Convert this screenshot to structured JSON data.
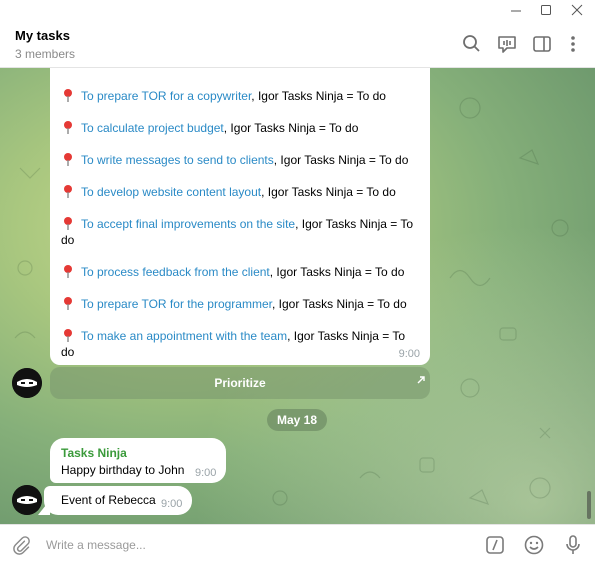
{
  "window": {
    "controls": [
      "minimize-icon",
      "maximize-icon",
      "close-icon"
    ]
  },
  "header": {
    "title": "My tasks",
    "subtitle": "3 members",
    "icons": [
      "search-icon",
      "voice-chat-icon",
      "sidebar-icon",
      "more-icon"
    ]
  },
  "messages": {
    "task_list": [
      {
        "link": "To prepare TOR for a copywriter",
        "rest": ", Igor Tasks Ninja = To do"
      },
      {
        "link": "To calculate project budget",
        "rest": ", Igor Tasks Ninja = To do"
      },
      {
        "link": "To write messages to send to clients",
        "rest": ", Igor Tasks Ninja = To do"
      },
      {
        "link": "To develop website content layout",
        "rest": ", Igor Tasks Ninja = To do"
      },
      {
        "link": "To accept final improvements on the site",
        "rest": ", Igor Tasks Ninja = To do"
      },
      {
        "link": "To process feedback from the client",
        "rest": ", Igor Tasks Ninja = To do"
      },
      {
        "link": "To prepare TOR for the programmer",
        "rest": ", Igor Tasks Ninja = To do"
      },
      {
        "link": "To make an appointment with the team",
        "rest": ", Igor Tasks Ninja = To do"
      }
    ],
    "task_list_time": "9:00",
    "inline_button": "Prioritize",
    "date_separator": "May 18",
    "sender": "Tasks Ninja",
    "msg1": {
      "text": "Happy birthday to John",
      "time": "9:00"
    },
    "msg2": {
      "text": "Event of Rebecca",
      "time": "9:00"
    }
  },
  "composer": {
    "placeholder": "Write a message...",
    "icons": [
      "attach-icon",
      "bot-commands-icon",
      "emoji-icon",
      "microphone-icon"
    ]
  },
  "colors": {
    "link": "#2a8ac6",
    "sender": "#3a9a3a",
    "chat_bg": "#86b07a"
  }
}
